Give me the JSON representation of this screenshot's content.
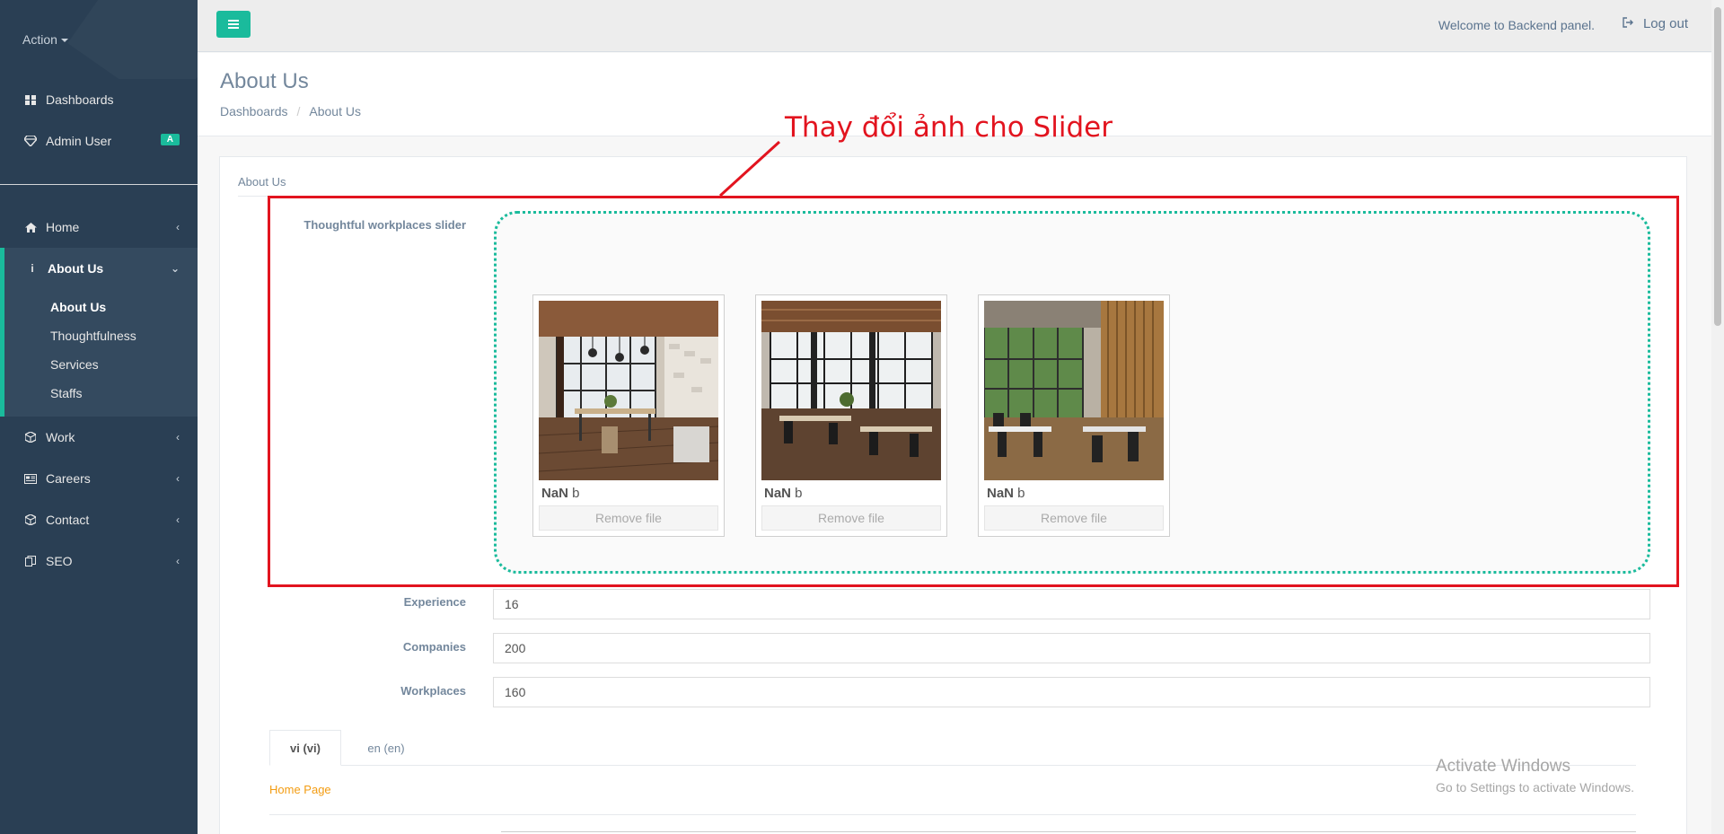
{
  "sidebar": {
    "action_label": "Action",
    "top_items": [
      {
        "label": "Dashboards",
        "icon": "dashboard-icon"
      },
      {
        "label": "Admin User",
        "icon": "diamond-icon",
        "badge": "A"
      }
    ],
    "items": [
      {
        "label": "Home",
        "icon": "home-icon"
      },
      {
        "label": "About Us",
        "icon": "info-icon"
      },
      {
        "label": "Work",
        "icon": "cube-icon"
      },
      {
        "label": "Careers",
        "icon": "newspaper-icon"
      },
      {
        "label": "Contact",
        "icon": "cube-icon"
      },
      {
        "label": "SEO",
        "icon": "copy-icon"
      }
    ],
    "about_submenu": [
      "About Us",
      "Thoughtfulness",
      "Services",
      "Staffs"
    ]
  },
  "topbar": {
    "welcome": "Welcome to Backend panel.",
    "logout": "Log out"
  },
  "page": {
    "title": "About Us",
    "breadcrumb": [
      "Dashboards",
      "About Us"
    ]
  },
  "panel": {
    "title": "About Us",
    "slider_label": "Thoughtful workplaces slider",
    "previews": [
      {
        "size_num": "NaN",
        "size_unit": " b",
        "remove": "Remove file"
      },
      {
        "size_num": "NaN",
        "size_unit": " b",
        "remove": "Remove file"
      },
      {
        "size_num": "NaN",
        "size_unit": " b",
        "remove": "Remove file"
      }
    ],
    "fields": [
      {
        "label": "Experience",
        "value": "16"
      },
      {
        "label": "Companies",
        "value": "200"
      },
      {
        "label": "Workplaces",
        "value": "160"
      }
    ],
    "tabs": [
      "vi (vi)",
      "en (en)"
    ],
    "home_page_link": "Home Page"
  },
  "annotation": {
    "text": "Thay đổi ảnh cho Slider",
    "color": "#E2141F"
  },
  "watermark": {
    "line1": "Activate Windows",
    "line2": "Go to Settings to activate Windows."
  },
  "colors": {
    "sidebar_bg": "#2A3F54",
    "accent": "#1ABB9C",
    "link_orange": "#F39C12"
  }
}
